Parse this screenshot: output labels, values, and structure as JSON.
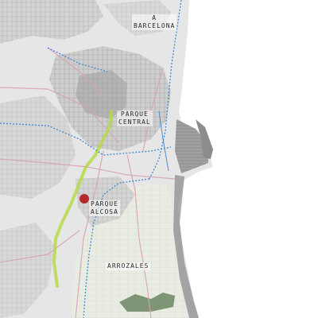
{
  "labels": {
    "barcelona_line1": "A",
    "barcelona_line2": "BARCELONA",
    "central_line1": "PARQUE",
    "central_line2": "CENTRAL",
    "alcosa_line1": "PARQUE",
    "alcosa_line2": "ALCOSA",
    "arrozales": "ARROZALES"
  },
  "colors": {
    "sea": "#ffffff",
    "land": "#e6e6e6",
    "urban": "#bdbdbd",
    "rail": "#4a8fd6",
    "green_corridor": "#b6d84a",
    "roads": "#d9a3b3",
    "marker": "#b22a2a",
    "rice_fields": "#dfe6d6"
  }
}
